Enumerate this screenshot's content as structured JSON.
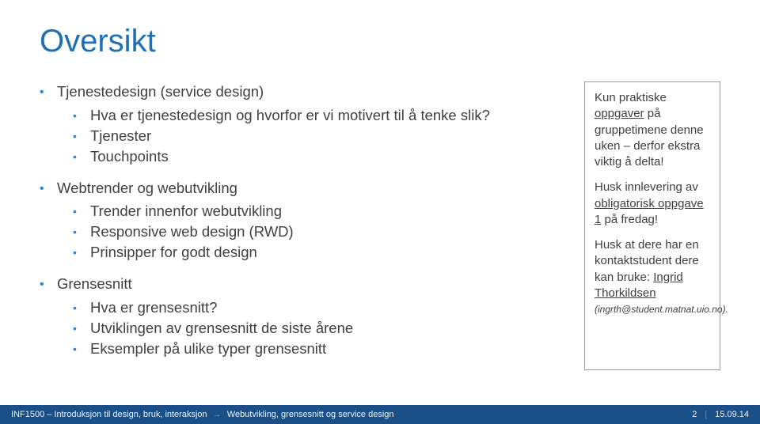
{
  "title": "Oversikt",
  "outline": {
    "g1": {
      "label": "Tjenestedesign (service design)",
      "items": [
        "Hva er tjenestedesign og hvorfor er vi motivert til å tenke slik?",
        "Tjenester",
        "Touchpoints"
      ]
    },
    "g2": {
      "label": "Webtrender og webutvikling",
      "items": [
        "Trender innenfor webutvikling",
        "Responsive web design (RWD)",
        "Prinsipper for godt design"
      ]
    },
    "g3": {
      "label": "Grensesnitt",
      "items": [
        "Hva er grensesnitt?",
        "Utviklingen av grensesnitt de siste årene",
        "Eksempler på ulike typer grensesnitt"
      ]
    }
  },
  "sidebar": {
    "p1_a": "Kun praktiske ",
    "p1_b": "oppgaver",
    "p1_c": " på gruppetimene denne uken – derfor ekstra viktig å delta!",
    "p2_a": "Husk innlevering av ",
    "p2_b": "obligatorisk oppgave 1",
    "p2_c": " på fredag!",
    "p3_a": "Husk at dere har en kontaktstudent dere kan bruke: ",
    "p3_b": "Ingrid Thorkildsen",
    "p3_email": "(ingrth@student.matnat.uio.no)."
  },
  "footer": {
    "course": "INF1500 – Introduksjon til design, bruk, interaksjon",
    "topic": "Webutvikling, grensesnitt og service design",
    "page": "2",
    "date": "15.09.14"
  }
}
